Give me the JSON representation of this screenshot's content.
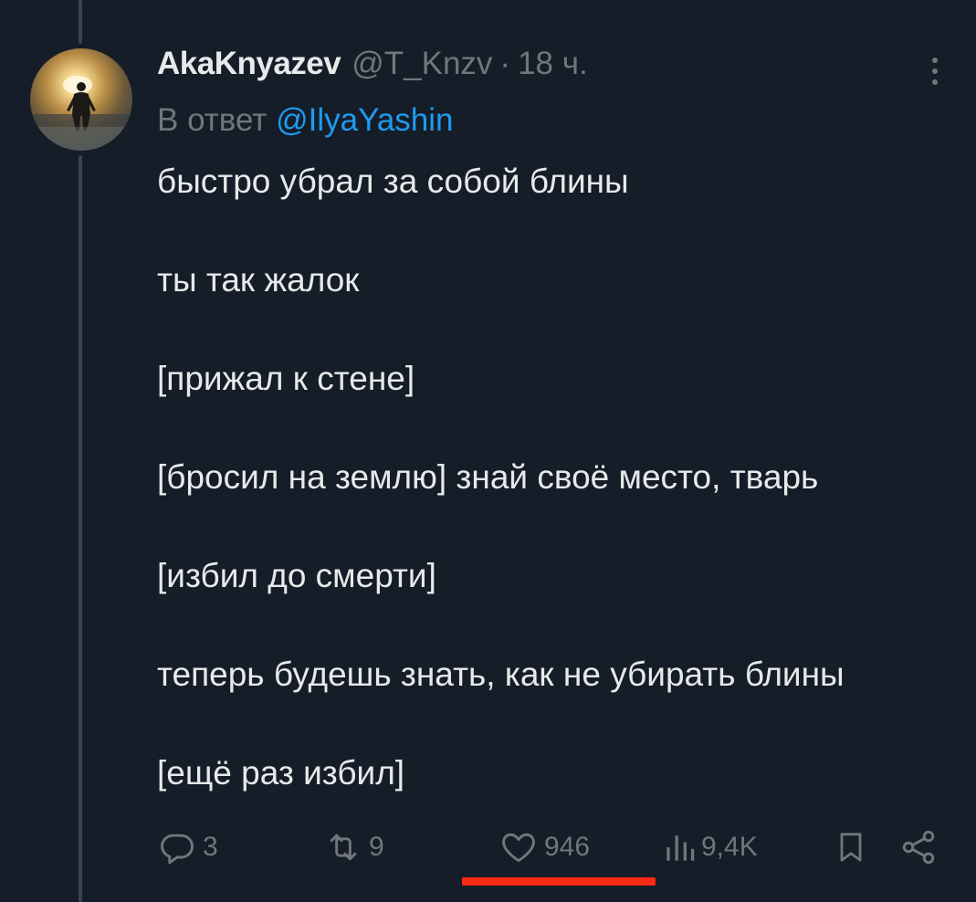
{
  "tweet": {
    "author": {
      "display_name": "AkaKnyazev",
      "handle": "@T_Knzv",
      "separator": "·",
      "time": "18 ч."
    },
    "reply_to": {
      "prefix": "В ответ",
      "mention": "@IlyaYashin"
    },
    "body_lines": [
      "быстро убрал за собой блины",
      "ты так жалок",
      "[прижал к стене]",
      "[бросил на землю] знай своё место, тварь",
      "[избил до смерти]",
      "теперь будешь знать, как не убирать блины",
      "[ещё раз избил]"
    ],
    "metrics": {
      "replies": "3",
      "retweets": "9",
      "likes": "946",
      "views": "9,4K"
    }
  },
  "icons": {
    "more": "more-vertical-icon",
    "reply": "reply-icon",
    "retweet": "retweet-icon",
    "like": "heart-icon",
    "views": "views-bar-chart-icon",
    "bookmark": "bookmark-icon",
    "share": "share-icon"
  },
  "colors": {
    "background": "#151d28",
    "text": "#e7e9ea",
    "muted": "#71767b",
    "link": "#1d9bf0",
    "underline_annotation": "#ff2a12"
  }
}
